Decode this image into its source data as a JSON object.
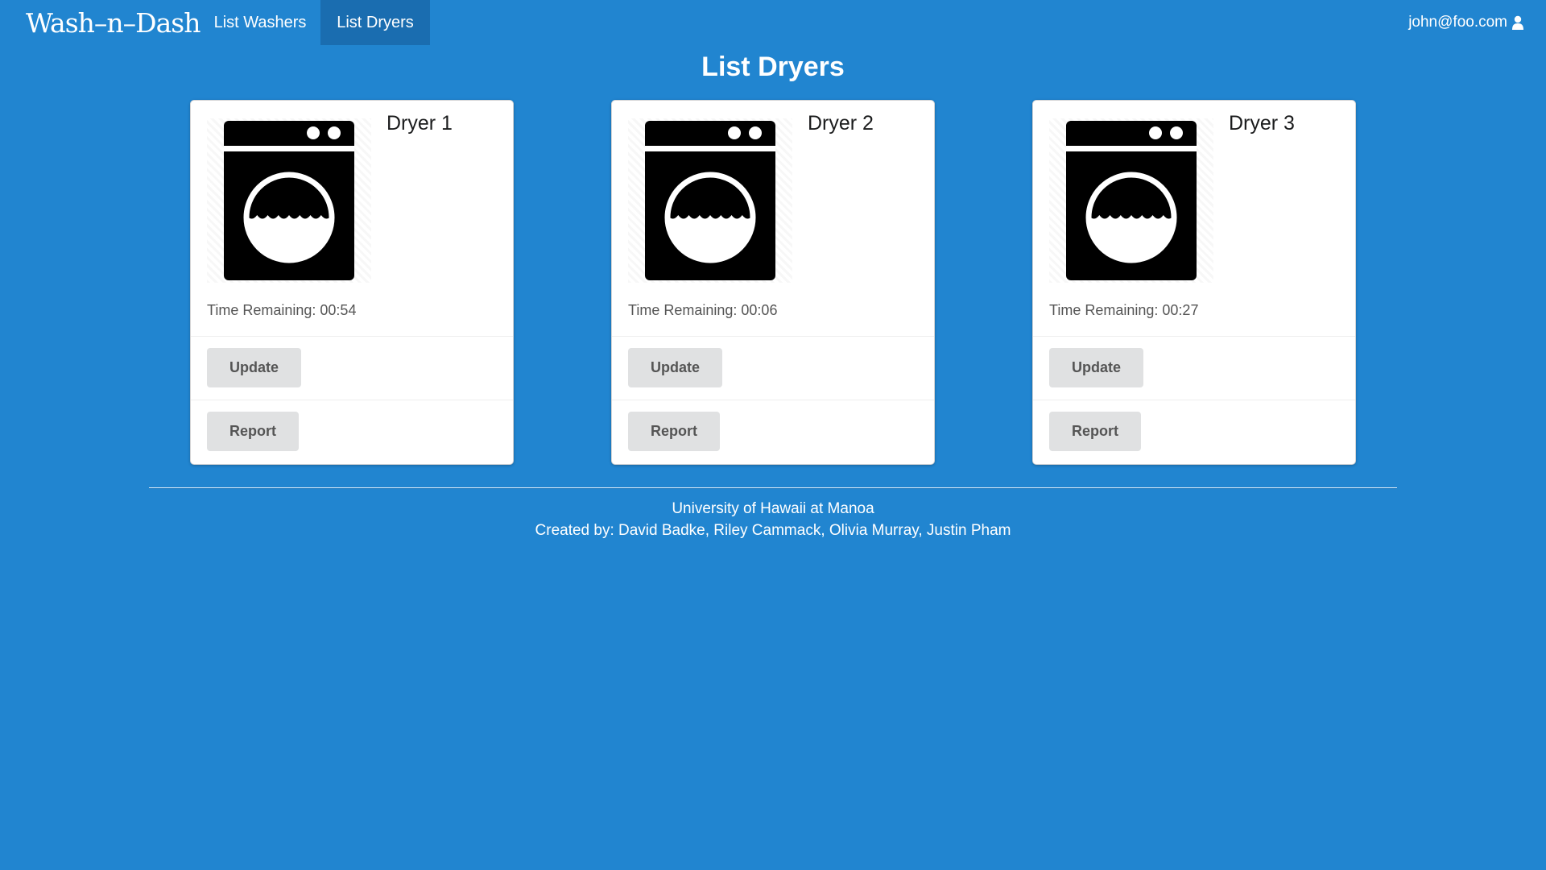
{
  "app": {
    "logo_text": "Wash–n–Dash"
  },
  "nav": {
    "items": [
      {
        "label": "List Washers",
        "active": false
      },
      {
        "label": "List Dryers",
        "active": true
      }
    ],
    "user_email": "john@foo.com",
    "user_icon": "user-icon"
  },
  "page": {
    "title": "List Dryers"
  },
  "dryers": [
    {
      "name": "Dryer 1",
      "time_label": "Time Remaining:",
      "time_value": "00:54",
      "update_label": "Update",
      "report_label": "Report",
      "icon": "dryer-machine-icon"
    },
    {
      "name": "Dryer 2",
      "time_label": "Time Remaining:",
      "time_value": "00:06",
      "update_label": "Update",
      "report_label": "Report",
      "icon": "dryer-machine-icon"
    },
    {
      "name": "Dryer 3",
      "time_label": "Time Remaining:",
      "time_value": "00:27",
      "update_label": "Update",
      "report_label": "Report",
      "icon": "dryer-machine-icon"
    }
  ],
  "footer": {
    "line1": "University of Hawaii at Manoa",
    "line2": "Created by: David Badke, Riley Cammack, Olivia Murray, Justin Pham"
  },
  "colors": {
    "background": "#2185d0",
    "active_nav": "#1a6db0",
    "button_bg": "#e0e1e2",
    "button_text": "#555555"
  }
}
